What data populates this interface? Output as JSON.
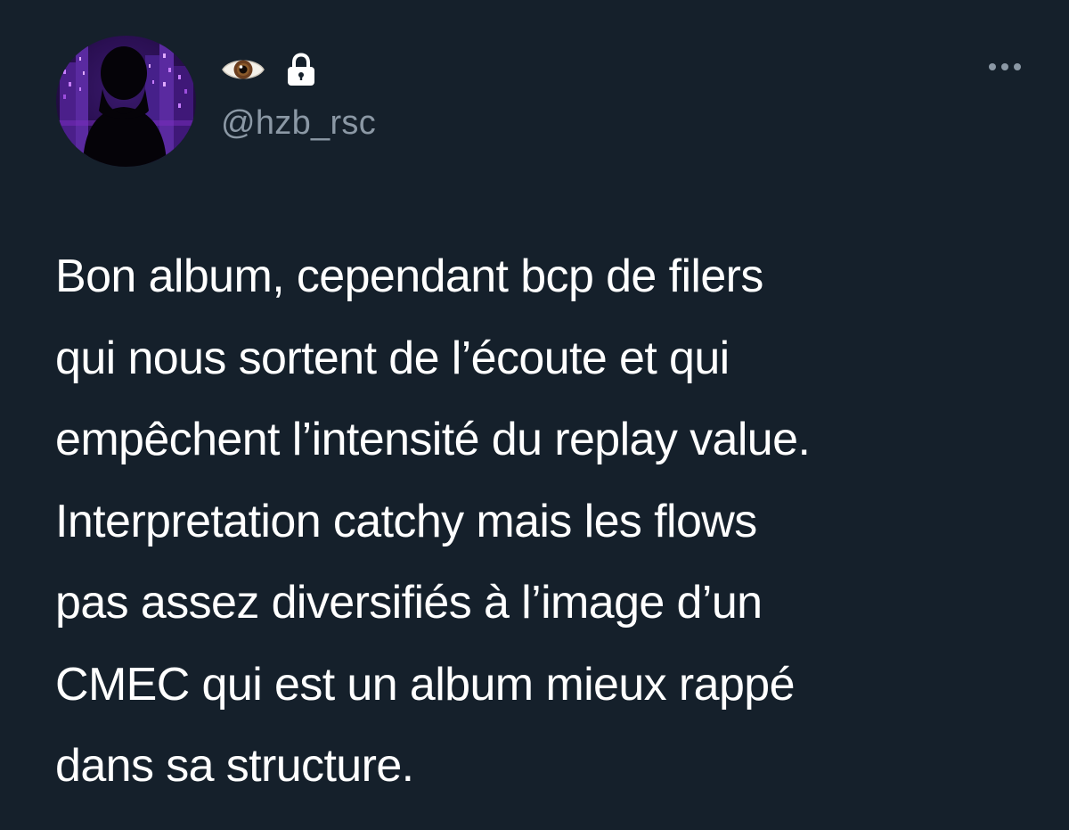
{
  "author": {
    "handle": "@hzb_rsc",
    "name_icons": [
      "eye-icon",
      "lock-icon"
    ],
    "avatar_icon": "silhouette-avatar"
  },
  "menu": {
    "more_icon": "more-horizontal-icon"
  },
  "tweet": {
    "lines": [
      "Bon album, cependant bcp de filers",
      "qui nous sortent de l’écoute et qui",
      "empêchent l’intensité du replay value.",
      "Interpretation catchy mais les flows",
      "pas assez diversifiés à l’image d’un",
      "CMEC qui est un album mieux rappé",
      "dans sa structure."
    ]
  },
  "colors": {
    "background": "#15202b",
    "text_primary": "#ffffff",
    "text_secondary": "#8b98a5",
    "avatar_glow": "#8a2be2"
  }
}
